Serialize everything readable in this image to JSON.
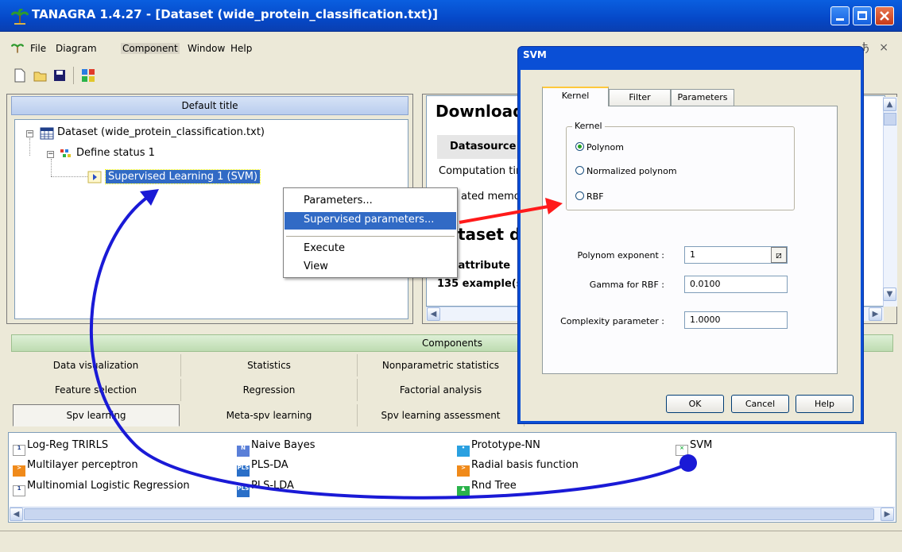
{
  "window": {
    "title": "TANAGRA 1.4.27 - [Dataset (wide_protein_classification.txt)]",
    "icon": "palm-tree-icon"
  },
  "menu": [
    "File",
    "Diagram",
    "Component",
    "Window",
    "Help"
  ],
  "mdi_controls": "ђ ×",
  "tree": {
    "header": "Default title",
    "nodes": [
      {
        "label": "Dataset (wide_protein_classification.txt)",
        "icon": "table-icon"
      },
      {
        "label": "Define status 1",
        "icon": "define-status-icon"
      },
      {
        "label": "Supervised Learning 1 (SVM)",
        "icon": "supervised-learning-icon",
        "selected": true
      }
    ]
  },
  "context_menu": {
    "items": [
      "Parameters...",
      "Supervised parameters...",
      "Execute",
      "View"
    ],
    "highlighted": "Supervised parameters..."
  },
  "report": {
    "heading": "Download",
    "rows": [
      "Datasource p",
      "Computation tir",
      "ated memo"
    ],
    "heading2": "taset d",
    "attributes": ") attribute",
    "examples": "135 example(s)"
  },
  "components": {
    "header": "Components",
    "tab_rows": [
      [
        "Data visualization",
        "Statistics",
        "Nonparametric statistics"
      ],
      [
        "Feature selection",
        "Regression",
        "Factorial analysis"
      ],
      [
        "Spv learning",
        "Meta-spv learning",
        "Spv learning assessment"
      ]
    ],
    "active_tab": "Spv learning",
    "items": [
      {
        "label": "Log-Reg TRIRLS",
        "icon": "logistic-icon"
      },
      {
        "label": "Multilayer perceptron",
        "icon": "network-icon"
      },
      {
        "label": "Multinomial Logistic Regression",
        "icon": "logistic-icon"
      },
      {
        "label": "Naive Bayes",
        "icon": "naive-bayes-icon"
      },
      {
        "label": "PLS-DA",
        "icon": "pls-icon"
      },
      {
        "label": "PLS-LDA",
        "icon": "pls-icon"
      },
      {
        "label": "Prototype-NN",
        "icon": "prototype-icon"
      },
      {
        "label": "Radial basis function",
        "icon": "network-icon"
      },
      {
        "label": "Rnd Tree",
        "icon": "tree-icon"
      },
      {
        "label": "SVM",
        "icon": "svm-icon"
      }
    ]
  },
  "dialog": {
    "title": "SVM",
    "tabs": [
      "Kernel",
      "Filter",
      "Parameters"
    ],
    "active_tab": "Kernel",
    "kernel_group_label": "Kernel",
    "kernel_options": [
      "Polynom",
      "Normalized polynom",
      "RBF"
    ],
    "kernel_selected": "Polynom",
    "fields": {
      "polynom_exponent": {
        "label": "Polynom exponent :",
        "value": "1"
      },
      "gamma": {
        "label": "Gamma for RBF :",
        "value": "0.0100"
      },
      "complexity": {
        "label": "Complexity parameter :",
        "value": "1.0000"
      }
    },
    "buttons": {
      "ok": "OK",
      "cancel": "Cancel",
      "help": "Help"
    }
  },
  "colors": {
    "titlebar": "#0548c8",
    "selection": "#316ac5",
    "red_arrow": "#ff1a1a",
    "blue_arrow": "#1a1ad6"
  }
}
